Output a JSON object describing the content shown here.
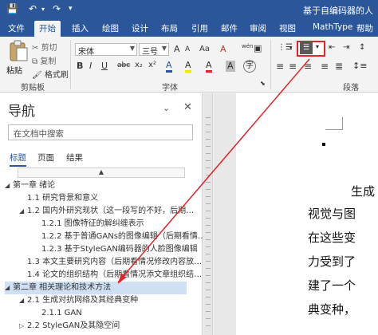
{
  "titlebar": {
    "save_icon": "save-icon",
    "undo_icon": "undo-icon",
    "redo_icon": "redo-icon",
    "doc_title": "基于自编码器的人"
  },
  "menu": {
    "tabs": [
      "文件",
      "开始",
      "插入",
      "绘图",
      "设计",
      "布局",
      "引用",
      "邮件",
      "审阅",
      "视图",
      "MathType",
      "帮助"
    ],
    "active": "开始"
  },
  "ribbon": {
    "paste": "粘贴",
    "cut": "剪切",
    "copy": "复制",
    "format_painter": "格式刷",
    "clipboard_label": "剪贴板",
    "font_name": "宋体",
    "font_size": "三号",
    "grow": "A",
    "shrink": "A",
    "case": "Aa",
    "clear": "A",
    "wen": "wén",
    "bold": "B",
    "italic": "I",
    "underline": "U",
    "strike": "abc",
    "sub": "x₂",
    "sup": "x²",
    "font_color_a": "A",
    "highlight": "A",
    "font_color_b": "A",
    "char_shade": "A",
    "font_label": "字体",
    "paragraph_label": "段落"
  },
  "nav": {
    "title": "导航",
    "search_placeholder": "在文档中搜索",
    "tabs": [
      "标题",
      "页面",
      "结果"
    ],
    "active_tab": "标题",
    "scroll_up": "▲",
    "items": [
      "第一章 绪论",
      "1.1 研究背景和意义",
      "1.2 国内外研究现状（这一段写的不好，后期…",
      "1.2.1 图像特征的解纠缠表示",
      "1.2.2 基于普通GANs的图像编辑（后期看情…",
      "1.2.3 基于StyleGAN编码器的人脸图像编辑",
      "1.3 本文主要研究内容（后期看情况修改内容放…",
      "1.4 论文的组织结构（后期看情况添文章组织结…",
      "第二章 相关理论和技术方法",
      "2.1 生成对抗网络及其经典变种",
      "2.1.1 GAN",
      "2.2 StyleGAN及其隐空间"
    ]
  },
  "document": {
    "lines": [
      "生成",
      "视觉与图",
      "在这些变",
      "力受到了",
      "建了一个",
      "典变种，"
    ]
  },
  "colors": {
    "ribbon_blue": "#2b579a",
    "annotation_red": "#e0242b",
    "selected_bg": "#cfe0f5"
  }
}
